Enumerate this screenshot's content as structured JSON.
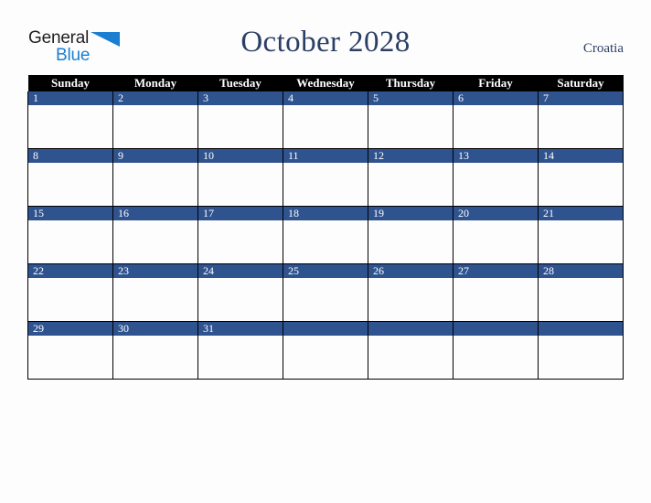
{
  "brand": {
    "name_top": "General",
    "name_bottom": "Blue",
    "triangle_color": "#1b7fd1",
    "top_color": "#231f20",
    "bottom_color": "#1b7fd1"
  },
  "header": {
    "title": "October 2028",
    "region": "Croatia",
    "title_color": "#2b3f66"
  },
  "calendar": {
    "month": "October",
    "year": "2028",
    "weekday_headers": [
      "Sunday",
      "Monday",
      "Tuesday",
      "Wednesday",
      "Thursday",
      "Friday",
      "Saturday"
    ],
    "header_bg": "#000000",
    "header_fg": "#ffffff",
    "daybar_bg": "#2f538f",
    "daybar_fg": "#ffffff",
    "cell_bg": "#fdfdfd",
    "border_color": "#000000",
    "weeks": [
      {
        "days": [
          {
            "num": "1",
            "events": ""
          },
          {
            "num": "2",
            "events": ""
          },
          {
            "num": "3",
            "events": ""
          },
          {
            "num": "4",
            "events": ""
          },
          {
            "num": "5",
            "events": ""
          },
          {
            "num": "6",
            "events": ""
          },
          {
            "num": "7",
            "events": ""
          }
        ]
      },
      {
        "days": [
          {
            "num": "8",
            "events": ""
          },
          {
            "num": "9",
            "events": ""
          },
          {
            "num": "10",
            "events": ""
          },
          {
            "num": "11",
            "events": ""
          },
          {
            "num": "12",
            "events": ""
          },
          {
            "num": "13",
            "events": ""
          },
          {
            "num": "14",
            "events": ""
          }
        ]
      },
      {
        "days": [
          {
            "num": "15",
            "events": ""
          },
          {
            "num": "16",
            "events": ""
          },
          {
            "num": "17",
            "events": ""
          },
          {
            "num": "18",
            "events": ""
          },
          {
            "num": "19",
            "events": ""
          },
          {
            "num": "20",
            "events": ""
          },
          {
            "num": "21",
            "events": ""
          }
        ]
      },
      {
        "days": [
          {
            "num": "22",
            "events": ""
          },
          {
            "num": "23",
            "events": ""
          },
          {
            "num": "24",
            "events": ""
          },
          {
            "num": "25",
            "events": ""
          },
          {
            "num": "26",
            "events": ""
          },
          {
            "num": "27",
            "events": ""
          },
          {
            "num": "28",
            "events": ""
          }
        ]
      },
      {
        "days": [
          {
            "num": "29",
            "events": ""
          },
          {
            "num": "30",
            "events": ""
          },
          {
            "num": "31",
            "events": ""
          },
          {
            "num": " ",
            "events": ""
          },
          {
            "num": " ",
            "events": ""
          },
          {
            "num": " ",
            "events": ""
          },
          {
            "num": " ",
            "events": ""
          }
        ]
      }
    ]
  }
}
